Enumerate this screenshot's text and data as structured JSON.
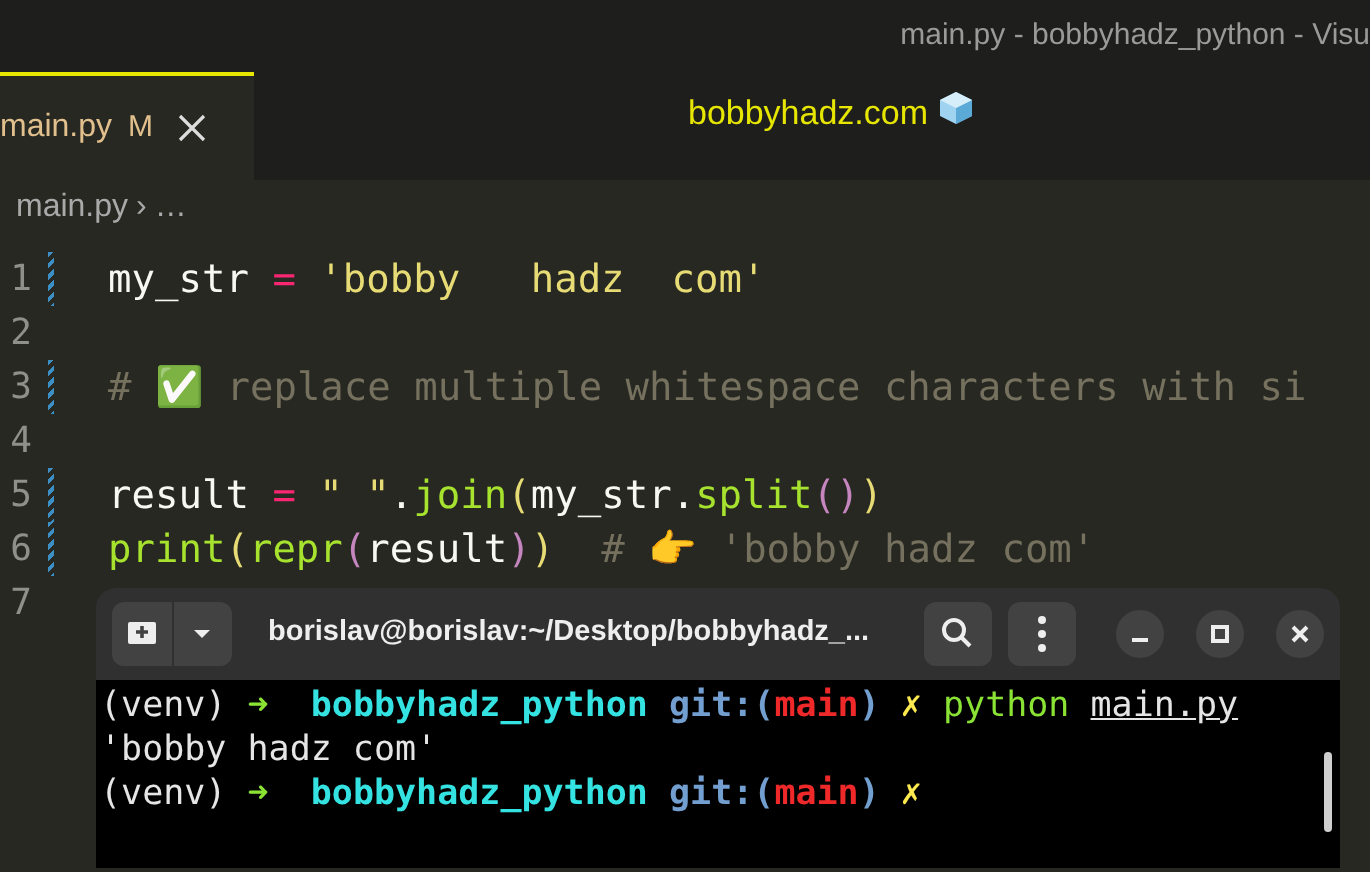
{
  "window": {
    "title": "main.py - bobbyhadz_python - Visu"
  },
  "tabs": [
    {
      "label": "main.py",
      "badge": "M",
      "selected": true
    }
  ],
  "watermark_banner": {
    "text": "bobbyhadz.com"
  },
  "breadcrumb": {
    "file": "main.py",
    "separator": "›",
    "rest": "…"
  },
  "editor": {
    "lines": [
      {
        "number": "1",
        "changed": true,
        "tokens": [
          {
            "kind": "plain",
            "text": "my_str "
          },
          {
            "kind": "op",
            "text": "="
          },
          {
            "kind": "string",
            "text": " 'bobby   hadz  com'"
          }
        ]
      },
      {
        "number": "2",
        "changed": false
      },
      {
        "number": "3",
        "changed": true,
        "tokens": [
          {
            "kind": "comment",
            "text": "# ✅ replace multiple whitespace characters with si"
          }
        ]
      },
      {
        "number": "4",
        "changed": false
      },
      {
        "number": "5",
        "changed": true,
        "tokens": [
          {
            "kind": "plain",
            "text": "result "
          },
          {
            "kind": "op",
            "text": "="
          },
          {
            "kind": "string",
            "text": " \" \""
          },
          {
            "kind": "plain",
            "text": "."
          },
          {
            "kind": "func",
            "text": "join"
          },
          {
            "kind": "paren",
            "text": "("
          },
          {
            "kind": "plain",
            "text": "my_str."
          },
          {
            "kind": "func",
            "text": "split"
          },
          {
            "kind": "paren2",
            "text": "()"
          },
          {
            "kind": "paren",
            "text": ")"
          }
        ]
      },
      {
        "number": "6",
        "changed": true,
        "tokens": [
          {
            "kind": "func",
            "text": "print"
          },
          {
            "kind": "paren",
            "text": "("
          },
          {
            "kind": "func",
            "text": "repr"
          },
          {
            "kind": "paren2",
            "text": "("
          },
          {
            "kind": "plain",
            "text": "result"
          },
          {
            "kind": "paren2",
            "text": ")"
          },
          {
            "kind": "paren",
            "text": ")"
          },
          {
            "kind": "comment",
            "text": "  # 👉 'bobby hadz com'"
          }
        ]
      },
      {
        "number": "7",
        "changed": false
      }
    ]
  },
  "terminal": {
    "title": "borislav@borislav:~/Desktop/bobbyhadz_...",
    "lines": [
      [
        {
          "kind": "plain",
          "text": "(venv) "
        },
        {
          "kind": "arrow",
          "text": "➜  "
        },
        {
          "kind": "dir",
          "text": "bobbyhadz_python "
        },
        {
          "kind": "git",
          "text": "git:("
        },
        {
          "kind": "branch",
          "text": "main"
        },
        {
          "kind": "git",
          "text": ") "
        },
        {
          "kind": "dirty",
          "text": "✗ "
        },
        {
          "kind": "cmd",
          "text": "python "
        },
        {
          "kind": "arg",
          "text": "main.py"
        }
      ],
      [
        {
          "kind": "plain",
          "text": "'bobby hadz com'"
        }
      ],
      [
        {
          "kind": "plain",
          "text": "(venv) "
        },
        {
          "kind": "arrow",
          "text": "➜  "
        },
        {
          "kind": "dir",
          "text": "bobbyhadz_python "
        },
        {
          "kind": "git",
          "text": "git:("
        },
        {
          "kind": "branch",
          "text": "main"
        },
        {
          "kind": "git",
          "text": ") "
        },
        {
          "kind": "dirty",
          "text": "✗"
        }
      ]
    ]
  }
}
